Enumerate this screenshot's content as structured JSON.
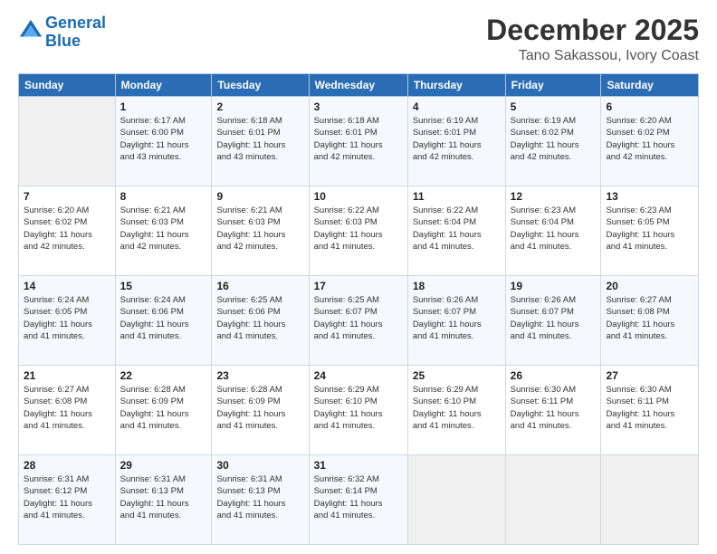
{
  "header": {
    "logo_line1": "General",
    "logo_line2": "Blue",
    "main_title": "December 2025",
    "subtitle": "Tano Sakassou, Ivory Coast"
  },
  "calendar": {
    "days_of_week": [
      "Sunday",
      "Monday",
      "Tuesday",
      "Wednesday",
      "Thursday",
      "Friday",
      "Saturday"
    ],
    "weeks": [
      [
        {
          "day": "",
          "info": ""
        },
        {
          "day": "1",
          "info": "Sunrise: 6:17 AM\nSunset: 6:00 PM\nDaylight: 11 hours\nand 43 minutes."
        },
        {
          "day": "2",
          "info": "Sunrise: 6:18 AM\nSunset: 6:01 PM\nDaylight: 11 hours\nand 43 minutes."
        },
        {
          "day": "3",
          "info": "Sunrise: 6:18 AM\nSunset: 6:01 PM\nDaylight: 11 hours\nand 42 minutes."
        },
        {
          "day": "4",
          "info": "Sunrise: 6:19 AM\nSunset: 6:01 PM\nDaylight: 11 hours\nand 42 minutes."
        },
        {
          "day": "5",
          "info": "Sunrise: 6:19 AM\nSunset: 6:02 PM\nDaylight: 11 hours\nand 42 minutes."
        },
        {
          "day": "6",
          "info": "Sunrise: 6:20 AM\nSunset: 6:02 PM\nDaylight: 11 hours\nand 42 minutes."
        }
      ],
      [
        {
          "day": "7",
          "info": "Sunrise: 6:20 AM\nSunset: 6:02 PM\nDaylight: 11 hours\nand 42 minutes."
        },
        {
          "day": "8",
          "info": "Sunrise: 6:21 AM\nSunset: 6:03 PM\nDaylight: 11 hours\nand 42 minutes."
        },
        {
          "day": "9",
          "info": "Sunrise: 6:21 AM\nSunset: 6:03 PM\nDaylight: 11 hours\nand 42 minutes."
        },
        {
          "day": "10",
          "info": "Sunrise: 6:22 AM\nSunset: 6:03 PM\nDaylight: 11 hours\nand 41 minutes."
        },
        {
          "day": "11",
          "info": "Sunrise: 6:22 AM\nSunset: 6:04 PM\nDaylight: 11 hours\nand 41 minutes."
        },
        {
          "day": "12",
          "info": "Sunrise: 6:23 AM\nSunset: 6:04 PM\nDaylight: 11 hours\nand 41 minutes."
        },
        {
          "day": "13",
          "info": "Sunrise: 6:23 AM\nSunset: 6:05 PM\nDaylight: 11 hours\nand 41 minutes."
        }
      ],
      [
        {
          "day": "14",
          "info": "Sunrise: 6:24 AM\nSunset: 6:05 PM\nDaylight: 11 hours\nand 41 minutes."
        },
        {
          "day": "15",
          "info": "Sunrise: 6:24 AM\nSunset: 6:06 PM\nDaylight: 11 hours\nand 41 minutes."
        },
        {
          "day": "16",
          "info": "Sunrise: 6:25 AM\nSunset: 6:06 PM\nDaylight: 11 hours\nand 41 minutes."
        },
        {
          "day": "17",
          "info": "Sunrise: 6:25 AM\nSunset: 6:07 PM\nDaylight: 11 hours\nand 41 minutes."
        },
        {
          "day": "18",
          "info": "Sunrise: 6:26 AM\nSunset: 6:07 PM\nDaylight: 11 hours\nand 41 minutes."
        },
        {
          "day": "19",
          "info": "Sunrise: 6:26 AM\nSunset: 6:07 PM\nDaylight: 11 hours\nand 41 minutes."
        },
        {
          "day": "20",
          "info": "Sunrise: 6:27 AM\nSunset: 6:08 PM\nDaylight: 11 hours\nand 41 minutes."
        }
      ],
      [
        {
          "day": "21",
          "info": "Sunrise: 6:27 AM\nSunset: 6:08 PM\nDaylight: 11 hours\nand 41 minutes."
        },
        {
          "day": "22",
          "info": "Sunrise: 6:28 AM\nSunset: 6:09 PM\nDaylight: 11 hours\nand 41 minutes."
        },
        {
          "day": "23",
          "info": "Sunrise: 6:28 AM\nSunset: 6:09 PM\nDaylight: 11 hours\nand 41 minutes."
        },
        {
          "day": "24",
          "info": "Sunrise: 6:29 AM\nSunset: 6:10 PM\nDaylight: 11 hours\nand 41 minutes."
        },
        {
          "day": "25",
          "info": "Sunrise: 6:29 AM\nSunset: 6:10 PM\nDaylight: 11 hours\nand 41 minutes."
        },
        {
          "day": "26",
          "info": "Sunrise: 6:30 AM\nSunset: 6:11 PM\nDaylight: 11 hours\nand 41 minutes."
        },
        {
          "day": "27",
          "info": "Sunrise: 6:30 AM\nSunset: 6:11 PM\nDaylight: 11 hours\nand 41 minutes."
        }
      ],
      [
        {
          "day": "28",
          "info": "Sunrise: 6:31 AM\nSunset: 6:12 PM\nDaylight: 11 hours\nand 41 minutes."
        },
        {
          "day": "29",
          "info": "Sunrise: 6:31 AM\nSunset: 6:13 PM\nDaylight: 11 hours\nand 41 minutes."
        },
        {
          "day": "30",
          "info": "Sunrise: 6:31 AM\nSunset: 6:13 PM\nDaylight: 11 hours\nand 41 minutes."
        },
        {
          "day": "31",
          "info": "Sunrise: 6:32 AM\nSunset: 6:14 PM\nDaylight: 11 hours\nand 41 minutes."
        },
        {
          "day": "",
          "info": ""
        },
        {
          "day": "",
          "info": ""
        },
        {
          "day": "",
          "info": ""
        }
      ]
    ]
  }
}
